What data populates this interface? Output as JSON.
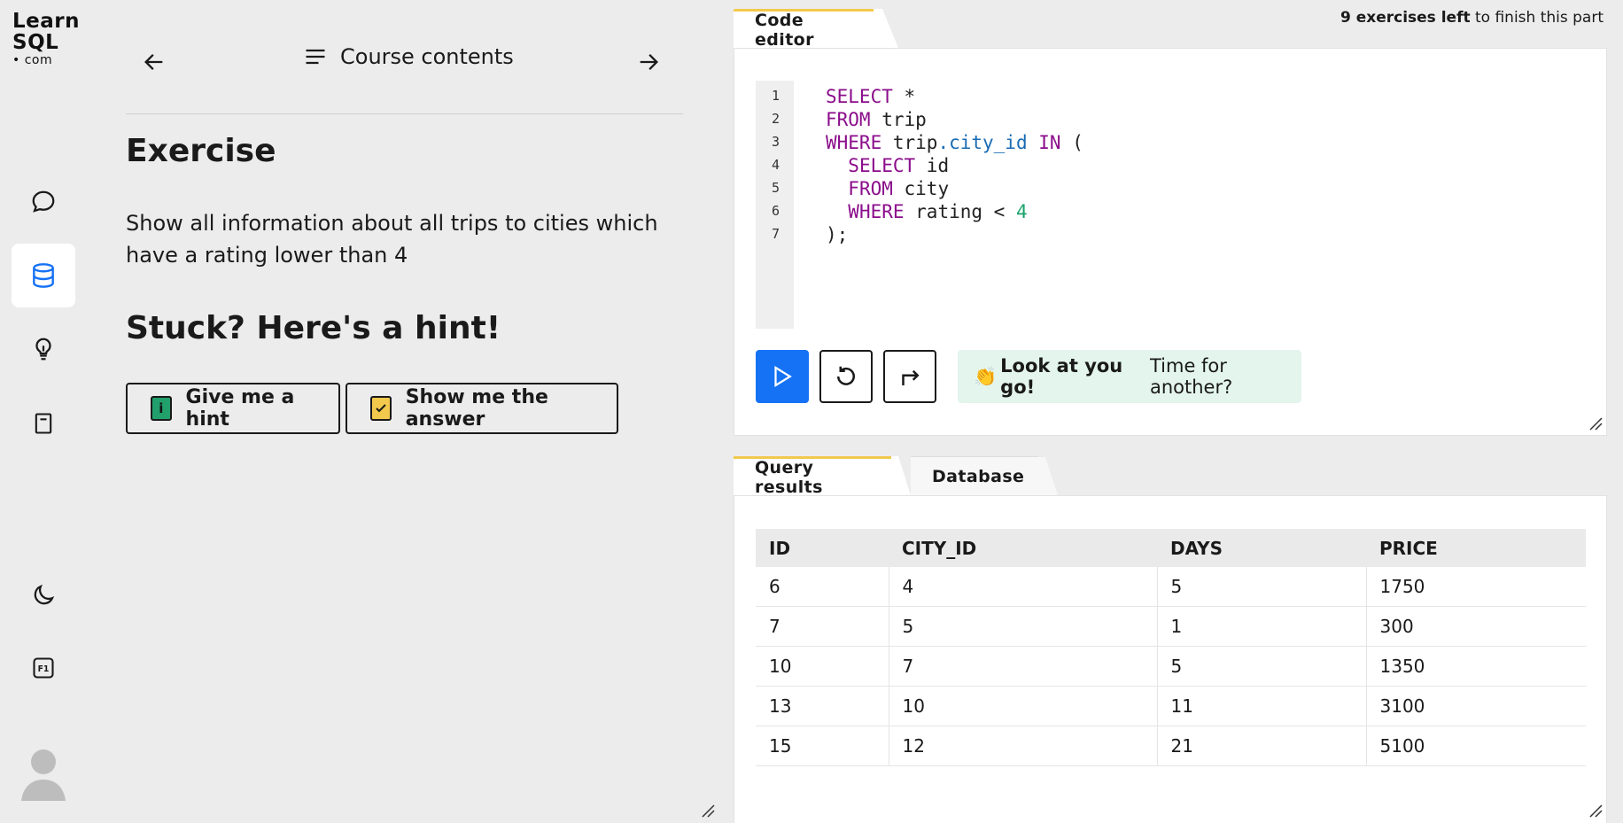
{
  "logo": {
    "line1": "Learn",
    "line2": "SQL",
    "line3": "• com"
  },
  "nav": {
    "contents_label": "Course contents"
  },
  "exercise": {
    "heading": "Exercise",
    "description": "Show all information about all trips to cities which have a rating lower than 4",
    "hint_heading": "Stuck? Here's a hint!",
    "hint_button": "Give me a hint",
    "hint_badge": "i",
    "answer_button": "Show me the answer"
  },
  "progress": {
    "count": "9 exercises left",
    "rest": " to finish this part"
  },
  "editor": {
    "tab": "Code editor",
    "line_numbers": [
      "1",
      "2",
      "3",
      "4",
      "5",
      "6",
      "7"
    ],
    "feedback_emoji": "👏",
    "feedback_bold": "Look at you go!",
    "feedback_text": " Time for another?"
  },
  "results": {
    "tabs": [
      "Query results",
      "Database"
    ],
    "columns": [
      "ID",
      "CITY_ID",
      "DAYS",
      "PRICE"
    ],
    "rows": [
      [
        "6",
        "4",
        "5",
        "1750"
      ],
      [
        "7",
        "5",
        "1",
        "300"
      ],
      [
        "10",
        "7",
        "5",
        "1350"
      ],
      [
        "13",
        "10",
        "11",
        "3100"
      ],
      [
        "15",
        "12",
        "21",
        "5100"
      ]
    ]
  },
  "colors": {
    "accent": "#1572f5",
    "tab_indicator": "#f2c94c",
    "hint_badge": "#22a06b",
    "answer_badge": "#f2c94c"
  }
}
